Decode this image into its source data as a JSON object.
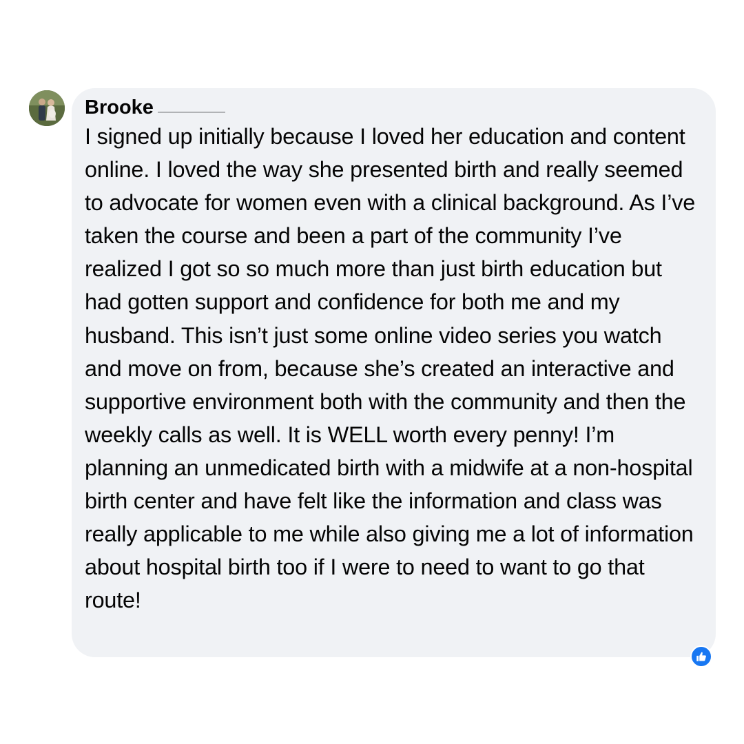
{
  "comment": {
    "author": "Brooke",
    "text": "I signed up initially because I loved her education and content online. I loved the way she presented birth and really seemed to advocate for women even with a clinical background. As I’ve taken the course and been a part of the community I’ve realized I got so so much more than just birth education but had gotten support and confidence for both me and my husband. This isn’t just some online video series you watch and move on from, because she’s created an interactive and supportive environment both with the community and then the weekly calls as well. It is WELL worth every penny! I’m planning an unmedicated birth with a midwife at a non-hospital birth center and have felt like the information and class was really applicable to me while also giving me a lot of information about hospital birth too if I were to need to want to go that route!",
    "reaction_icon": "like-thumbs-up-icon",
    "colors": {
      "bubble": "#f0f2f5",
      "text": "#050505",
      "like_badge": "#1877f2"
    }
  }
}
